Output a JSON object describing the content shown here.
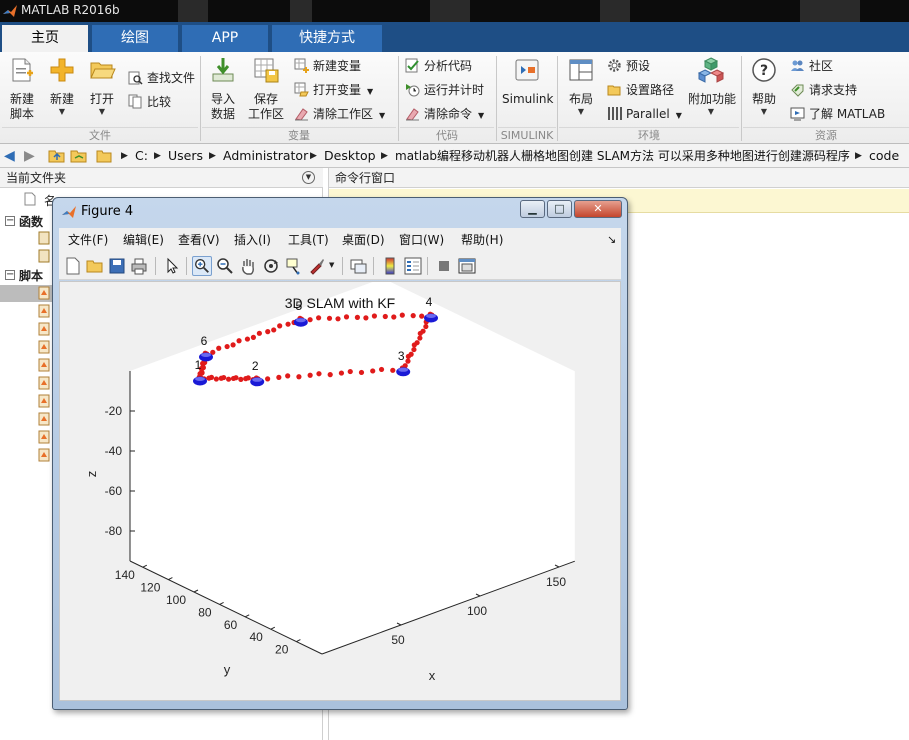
{
  "app": {
    "title": "MATLAB R2016b"
  },
  "tabs": [
    {
      "label": "主页",
      "active": true
    },
    {
      "label": "绘图",
      "active": false
    },
    {
      "label": "APP",
      "active": false
    },
    {
      "label": "快捷方式",
      "active": false
    }
  ],
  "ribbon": {
    "file": {
      "group": "文件",
      "new_script": [
        "新建",
        "脚本"
      ],
      "new": "新建",
      "open": "打开",
      "find_files": "查找文件",
      "compare": "比较"
    },
    "variable": {
      "group": "变量",
      "import": [
        "导入",
        "数据"
      ],
      "save_ws": [
        "保存",
        "工作区"
      ],
      "new_var": "新建变量",
      "open_var": "打开变量",
      "clear_ws": "清除工作区"
    },
    "code": {
      "group": "代码",
      "analyze": "分析代码",
      "run_time": "运行并计时",
      "clear_cmd": "清除命令"
    },
    "simulink": {
      "group": "SIMULINK",
      "label": "Simulink"
    },
    "environment": {
      "group": "环境",
      "layout": "布局",
      "prefs": "预设",
      "set_path": "设置路径",
      "parallel": "Parallel",
      "addons": "附加功能"
    },
    "resources": {
      "group": "资源",
      "help": "帮助",
      "community": "社区",
      "support": "请求支持",
      "learn": "了解 MATLAB"
    }
  },
  "address": {
    "crumbs": [
      "C:",
      "Users",
      "Administrator",
      "Desktop",
      "matlab编程移动机器人栅格地图创建 SLAM方法 可以采用多种地图进行创建源码程序",
      "code"
    ]
  },
  "left_panel": {
    "title": "当前文件夹",
    "name_col": "名",
    "sections": [
      "函数",
      "脚本"
    ]
  },
  "cmd_panel": {
    "title": "命令行窗口"
  },
  "figure": {
    "title": "Figure 4",
    "menu": [
      "文件(F)",
      "编辑(E)",
      "查看(V)",
      "插入(I)",
      "工具(T)",
      "桌面(D)",
      "窗口(W)",
      "帮助(H)"
    ],
    "menu_arrow": "↘"
  },
  "chart_data": {
    "type": "scatter",
    "title": "3D SLAM with KF",
    "xlabel": "x",
    "ylabel": "y",
    "zlabel": "z",
    "x_ticks": [
      50,
      100,
      150
    ],
    "y_ticks": [
      20,
      40,
      60,
      80,
      100,
      120,
      140
    ],
    "z_ticks": [
      -20,
      -40,
      -60,
      -80
    ],
    "landmarks": [
      {
        "label": "1",
        "x": 20,
        "y": 120,
        "z": 0
      },
      {
        "label": "2",
        "x": 40,
        "y": 100,
        "z": 0
      },
      {
        "label": "3",
        "x": 100,
        "y": 60,
        "z": 0
      },
      {
        "label": "4",
        "x": 150,
        "y": 100,
        "z": 0
      },
      {
        "label": "5",
        "x": 100,
        "y": 140,
        "z": 0
      },
      {
        "label": "6",
        "x": 40,
        "y": 140,
        "z": 0
      }
    ],
    "path_color": "#e01b1b",
    "landmark_color": "#1a1ad6"
  }
}
